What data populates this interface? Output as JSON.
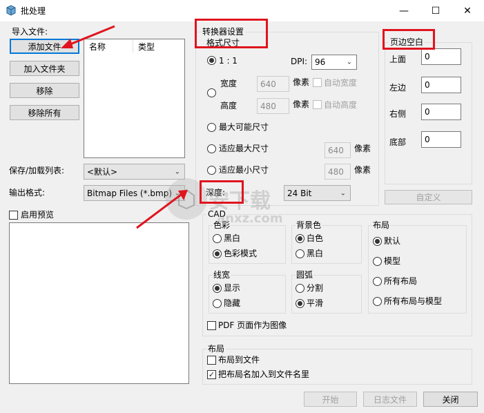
{
  "window": {
    "title": "批处理",
    "minimize_glyph": "—",
    "maximize_glyph": "☐",
    "close_glyph": "✕"
  },
  "import": {
    "header": "导入文件:",
    "add_file": "添加文件",
    "add_folder": "加入文件夹",
    "remove": "移除",
    "remove_all": "移除所有",
    "columns": [
      "名称",
      "类型"
    ],
    "save_load_label": "保存/加载列表:",
    "save_load_value": "<默认>",
    "output_format_label": "输出格式:",
    "output_format_value": "Bitmap Files (*.bmp)",
    "enable_preview": "启用预览"
  },
  "converter": {
    "title_line1": "转换器设置",
    "title_line2": "格式尺寸",
    "ratio_1_1": "1 : 1",
    "dpi_label": "DPI:",
    "dpi_value": "96",
    "width_label": "宽度",
    "width_value": "640",
    "height_label": "高度",
    "height_value": "480",
    "pixel_unit": "像素",
    "auto_width": "自动宽度",
    "auto_height": "自动高度",
    "max_possible": "最大可能尺寸",
    "fit_max": "适应最大尺寸",
    "fit_max_value": "640",
    "fit_min": "适应最小尺寸",
    "fit_min_value": "480",
    "depth_label": "深度:",
    "depth_value": "24 Bit"
  },
  "margins": {
    "title": "页边空白",
    "top_label": "上面",
    "top_value": "0",
    "left_label": "左边",
    "left_value": "0",
    "right_label": "右侧",
    "right_value": "0",
    "bottom_label": "底部",
    "bottom_value": "0",
    "custom_button": "自定义"
  },
  "cad": {
    "title": "CAD",
    "color_title": "色彩",
    "bw": "黑白",
    "color_mode": "色彩模式",
    "bg_title": "背景色",
    "white": "白色",
    "black": "黑白",
    "layout_title": "布局",
    "default": "默认",
    "model": "模型",
    "all_layouts": "所有布局",
    "all_layouts_model": "所有布局与模型",
    "linewidth_title": "线宽",
    "show": "显示",
    "hide": "隐藏",
    "arc_title": "圆弧",
    "split": "分割",
    "smooth": "平滑",
    "pdf_as_image": "PDF 页面作为图像"
  },
  "layout_section": {
    "title": "布局",
    "layout_to_file": "布局到文件",
    "add_layout_name": "把布局名加入到文件名里"
  },
  "footer": {
    "start": "开始",
    "log_file": "日志文件",
    "close": "关闭"
  },
  "watermark": {
    "text": "安下载",
    "sub": "anxz.com"
  },
  "colors": {
    "annotation_red": "#e0141e",
    "focus_blue": "#0078d7"
  }
}
